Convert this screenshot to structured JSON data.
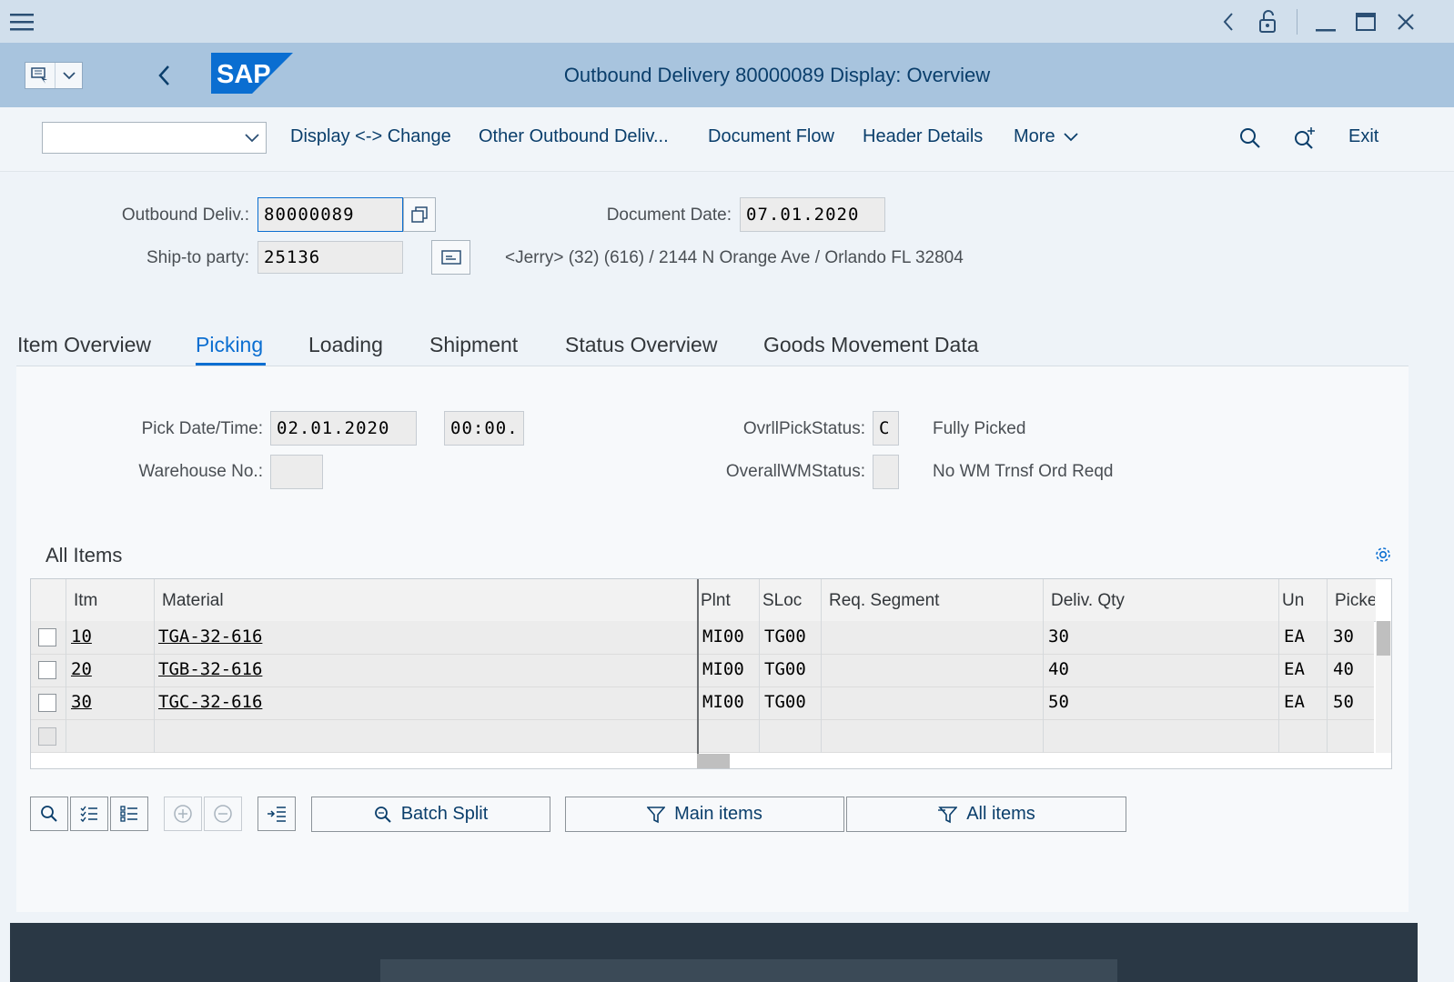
{
  "window": {
    "menu_icon": "hamburger-icon",
    "controls": [
      "back-arrow-icon",
      "unlock-icon",
      "minimize-icon",
      "maximize-icon",
      "close-icon"
    ]
  },
  "header": {
    "logo_text": "SAP",
    "title": "Outbound Delivery 80000089 Display: Overview",
    "accent": "#0a6ed1",
    "bar_color": "#a8c4de"
  },
  "toolbar": {
    "dropdown_value": "",
    "buttons": [
      "Display <-> Change",
      "Other Outbound Deliv...",
      "Document Flow",
      "Header Details",
      "More"
    ],
    "exit": "Exit"
  },
  "header_fields": {
    "outbound_deliv_label": "Outbound Deliv.:",
    "outbound_deliv_value": "80000089",
    "document_date_label": "Document Date:",
    "document_date_value": "07.01.2020",
    "ship_to_label": "Ship-to party:",
    "ship_to_value": "25136",
    "ship_to_address": "<Jerry> (32) (616) / 2144 N Orange Ave / Orlando FL 32804"
  },
  "tabs": [
    "Item Overview",
    "Picking",
    "Loading",
    "Shipment",
    "Status Overview",
    "Goods Movement Data"
  ],
  "active_tab": "Picking",
  "picking": {
    "pick_date_label": "Pick Date/Time:",
    "pick_date_value": "02.01.2020",
    "pick_time_value": "00:00.",
    "warehouse_label": "Warehouse No.:",
    "warehouse_value": "",
    "ovrl_pick_status_label": "OvrllPickStatus:",
    "ovrl_pick_status_value": "C",
    "ovrl_pick_status_text": "Fully Picked",
    "overall_wm_status_label": "OverallWMStatus:",
    "overall_wm_status_value": "",
    "overall_wm_status_text": "No WM Trnsf Ord Reqd"
  },
  "table": {
    "title": "All Items",
    "columns": [
      "Itm",
      "Material",
      "Plnt",
      "SLoc",
      "Req. Segment",
      "Deliv. Qty",
      "Un",
      "Picke"
    ],
    "rows": [
      {
        "itm": "10",
        "material": "TGA-32-616",
        "plnt": "MI00",
        "sloc": "TG00",
        "req_segment": "",
        "deliv_qty": "30",
        "un": "EA",
        "picked": "30"
      },
      {
        "itm": "20",
        "material": "TGB-32-616",
        "plnt": "MI00",
        "sloc": "TG00",
        "req_segment": "",
        "deliv_qty": "40",
        "un": "EA",
        "picked": "40"
      },
      {
        "itm": "30",
        "material": "TGC-32-616",
        "plnt": "MI00",
        "sloc": "TG00",
        "req_segment": "",
        "deliv_qty": "50",
        "un": "EA",
        "picked": "50"
      }
    ]
  },
  "bottom_buttons": {
    "batch_split": "Batch Split",
    "main_items": "Main items",
    "all_items": "All items"
  }
}
